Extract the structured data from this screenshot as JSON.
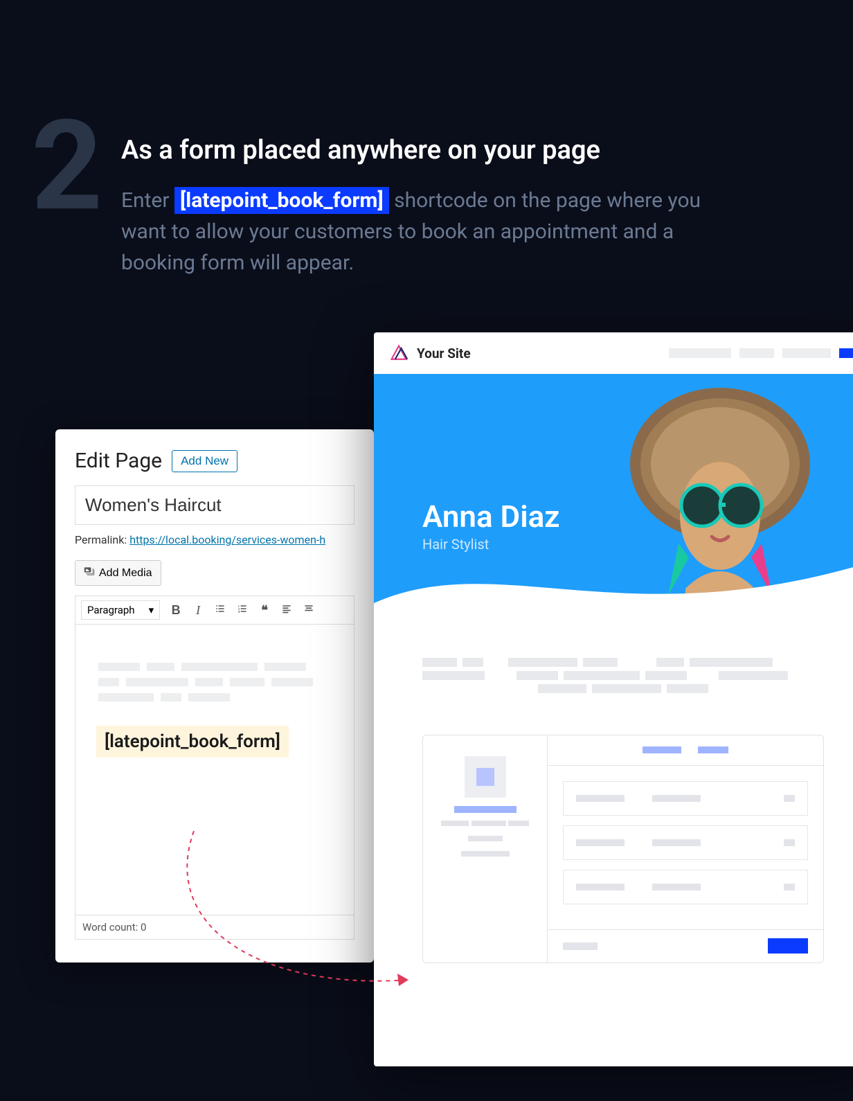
{
  "step_number": "2",
  "title": "As a form placed anywhere on your page",
  "desc_before": "Enter ",
  "shortcode_highlight": "[latepoint_book_form]",
  "desc_after": " shortcode on the page where you want to allow your customers to book an appointment and a booking form will appear.",
  "editor": {
    "heading": "Edit Page",
    "add_new": "Add New",
    "title_value": "Women's Haircut",
    "permalink_label": "Permalink:",
    "permalink_base": "https://local.booking/",
    "permalink_slug": "services-women-h",
    "add_media": "Add Media",
    "format": "Paragraph",
    "shortcode_text": "[latepoint_book_form]",
    "word_count_label": "Word count:",
    "word_count_value": "0"
  },
  "site": {
    "brand": "Your Site",
    "hero_name": "Anna Diaz",
    "hero_role": "Hair Stylist"
  }
}
